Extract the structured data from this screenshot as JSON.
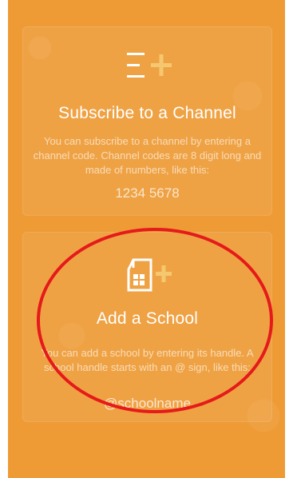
{
  "channel_card": {
    "title": "Subscribe to a Channel",
    "description": "You can subscribe to a channel by  entering a channel code. Channel codes are 8 digit long and made of numbers, like this:",
    "example": "1234 5678",
    "icon": "list-add-icon"
  },
  "school_card": {
    "title": "Add a School",
    "description": "You can add a school by entering its handle. A school handle starts with an @ sign, like this:",
    "example": "@schoolname",
    "icon": "school-add-icon"
  },
  "colors": {
    "background": "#ee9b36",
    "accent_plus": "#f5c86f",
    "highlight": "#e51a1a"
  }
}
